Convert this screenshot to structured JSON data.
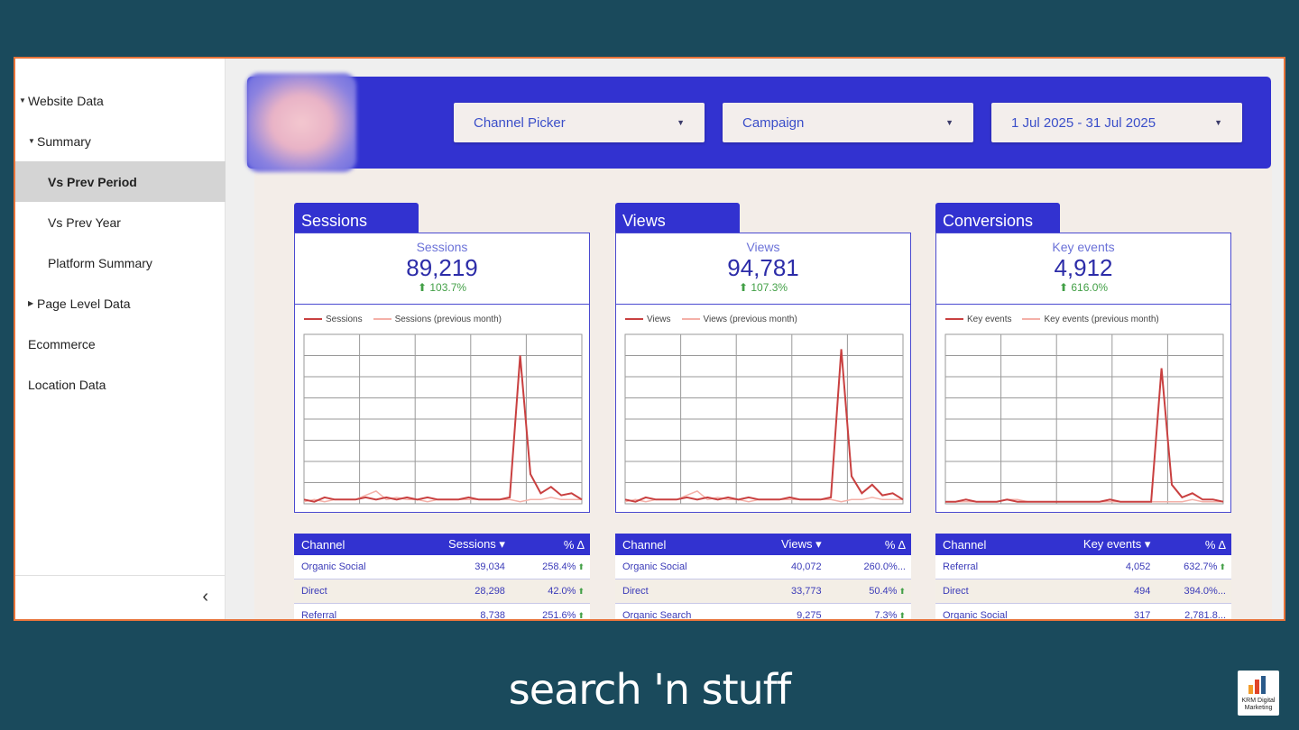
{
  "sidebar": {
    "items": [
      {
        "label": "Website Data",
        "indent": 0,
        "caret": "down"
      },
      {
        "label": "Summary",
        "indent": 1,
        "caret": "down"
      },
      {
        "label": "Vs Prev Period",
        "indent": 2,
        "active": true
      },
      {
        "label": "Vs Prev Year",
        "indent": 2
      },
      {
        "label": "Platform Summary",
        "indent": 2
      },
      {
        "label": "Page Level Data",
        "indent": 1,
        "caret": "right"
      },
      {
        "label": "Ecommerce",
        "indent": 1
      },
      {
        "label": "Location Data",
        "indent": 1
      }
    ],
    "collapse_glyph": "‹"
  },
  "filters": {
    "channel_picker": "Channel Picker",
    "campaign": "Campaign",
    "date_range": "1 Jul 2025 - 31 Jul 2025"
  },
  "cards": [
    {
      "tab": "Sessions",
      "metric_label": "Sessions",
      "value": "89,219",
      "delta": "103.7%",
      "legend_current": "Sessions",
      "legend_previous": "Sessions (previous month)",
      "table": {
        "headers": [
          "Channel",
          "Sessions ▾",
          "% Δ"
        ],
        "rows": [
          [
            "Organic Social",
            "39,034",
            "258.4%"
          ],
          [
            "Direct",
            "28,298",
            "42.0%"
          ],
          [
            "Referral",
            "8,738",
            "251.6%"
          ]
        ]
      }
    },
    {
      "tab": "Views",
      "metric_label": "Views",
      "value": "94,781",
      "delta": "107.3%",
      "legend_current": "Views",
      "legend_previous": "Views (previous month)",
      "table": {
        "headers": [
          "Channel",
          "Views ▾",
          "% Δ"
        ],
        "rows": [
          [
            "Organic Social",
            "40,072",
            "260.0%..."
          ],
          [
            "Direct",
            "33,773",
            "50.4%"
          ],
          [
            "Organic Search",
            "9,275",
            "7.3%"
          ]
        ]
      }
    },
    {
      "tab": "Conversions",
      "metric_label": "Key events",
      "value": "4,912",
      "delta": "616.0%",
      "legend_current": "Key events",
      "legend_previous": "Key events (previous month)",
      "table": {
        "headers": [
          "Channel",
          "Key events ▾",
          "% Δ"
        ],
        "rows": [
          [
            "Referral",
            "4,052",
            "632.7%"
          ],
          [
            "Direct",
            "494",
            "394.0%..."
          ],
          [
            "Organic Social",
            "317",
            "2,781.8..."
          ]
        ]
      }
    }
  ],
  "chart_data": [
    {
      "type": "line",
      "series": [
        {
          "name": "Sessions",
          "values": [
            2,
            1,
            3,
            2,
            2,
            2,
            3,
            2,
            3,
            2,
            3,
            2,
            3,
            2,
            2,
            2,
            3,
            2,
            2,
            2,
            3,
            70,
            14,
            5,
            8,
            4,
            5,
            2
          ]
        },
        {
          "name": "Sessions (previous month)",
          "values": [
            1,
            2,
            1,
            2,
            2,
            2,
            4,
            6,
            2,
            3,
            2,
            2,
            1,
            2,
            2,
            2,
            2,
            2,
            2,
            2,
            2,
            1,
            2,
            2,
            3,
            2,
            2,
            2
          ]
        }
      ]
    },
    {
      "type": "line",
      "series": [
        {
          "name": "Views",
          "values": [
            2,
            1,
            3,
            2,
            2,
            2,
            3,
            2,
            3,
            2,
            3,
            2,
            3,
            2,
            2,
            2,
            3,
            2,
            2,
            2,
            3,
            73,
            13,
            5,
            9,
            4,
            5,
            2
          ]
        },
        {
          "name": "Views (previous month)",
          "values": [
            1,
            2,
            1,
            2,
            2,
            2,
            4,
            6,
            2,
            3,
            2,
            2,
            1,
            2,
            2,
            2,
            2,
            2,
            2,
            2,
            2,
            1,
            2,
            2,
            3,
            2,
            2,
            2
          ]
        }
      ]
    },
    {
      "type": "line",
      "series": [
        {
          "name": "Key events",
          "values": [
            1,
            1,
            2,
            1,
            1,
            1,
            2,
            1,
            1,
            1,
            1,
            1,
            1,
            1,
            1,
            1,
            2,
            1,
            1,
            1,
            1,
            64,
            9,
            3,
            5,
            2,
            2,
            1
          ]
        },
        {
          "name": "Key events (previous month)",
          "values": [
            1,
            1,
            1,
            1,
            1,
            1,
            2,
            2,
            1,
            1,
            1,
            1,
            1,
            1,
            1,
            1,
            1,
            1,
            1,
            1,
            1,
            1,
            1,
            1,
            2,
            1,
            1,
            1
          ]
        }
      ]
    }
  ],
  "brand": {
    "text": "search 'n stuff",
    "logo_text": "KRM Digital Marketing"
  },
  "colors": {
    "accent": "#3232d0",
    "current_line": "#c94040",
    "previous_line": "#f4b0a8",
    "positive": "#43a047"
  }
}
